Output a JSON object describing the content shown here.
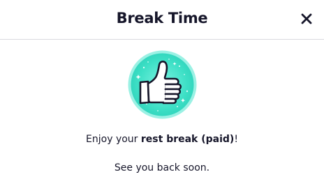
{
  "dialog": {
    "title": "Break Time",
    "close_icon": "close-icon",
    "illustration_icon": "thumbs-up-icon",
    "accent_color": "#3fe0c8",
    "message": {
      "prefix": "Enjoy your ",
      "highlight": "rest break (paid)",
      "suffix": "!"
    },
    "farewell": "See you back soon."
  }
}
